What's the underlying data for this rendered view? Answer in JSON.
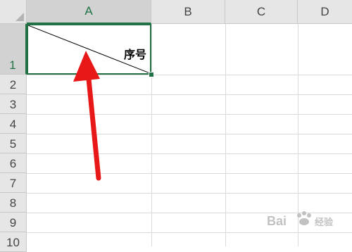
{
  "columns": [
    {
      "label": "A",
      "active": true
    },
    {
      "label": "B",
      "active": false
    },
    {
      "label": "C",
      "active": false
    },
    {
      "label": "D",
      "active": false
    }
  ],
  "rows": [
    "1",
    "2",
    "3",
    "4",
    "5",
    "6",
    "7",
    "8",
    "9",
    "10"
  ],
  "cell_a1": {
    "text": "序号",
    "diagonal_border": true
  },
  "colors": {
    "accent": "#217346",
    "arrow": "#e81818",
    "header_bg": "#e6e6e6"
  },
  "watermark": {
    "text": "Bai",
    "icon": "baidu-paw-icon",
    "suffix": "经验"
  }
}
